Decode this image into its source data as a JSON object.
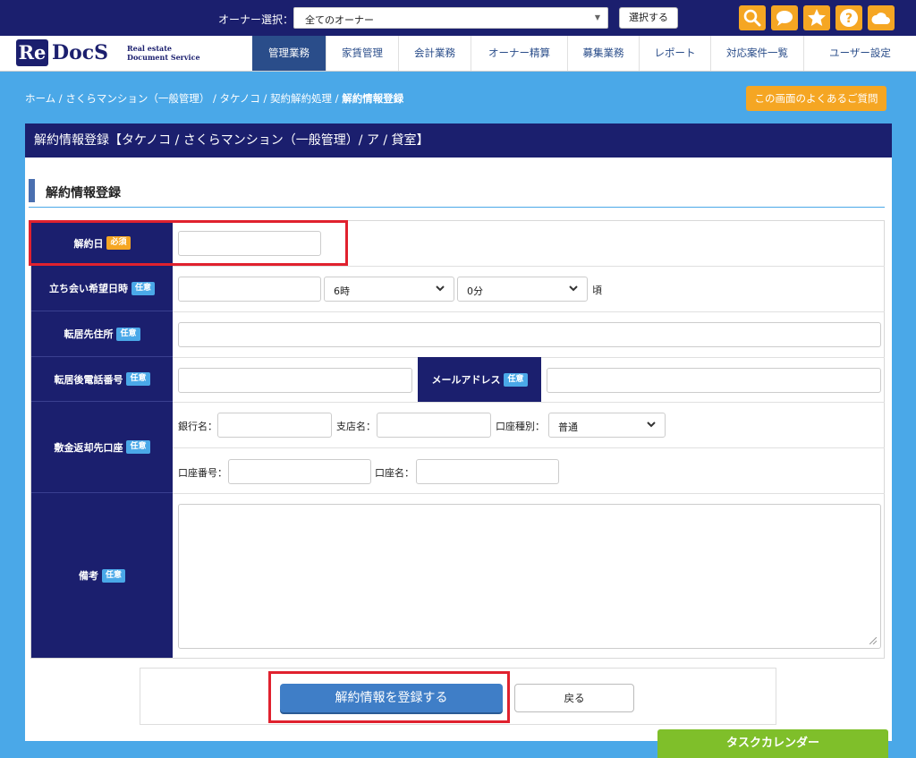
{
  "topbar": {
    "owner_label": "オーナー選択：",
    "owner_select_value": "全てのオーナー",
    "select_button": "選択する",
    "icons": [
      "search-icon",
      "chat-icon",
      "star-icon",
      "help-icon",
      "cloud-icon"
    ]
  },
  "logo": {
    "re": "Re",
    "docs": "DocS",
    "sub_line1": "Real estate",
    "sub_line2": "Document Service"
  },
  "nav": {
    "items": [
      "管理業務",
      "家賃管理",
      "会計業務",
      "オーナー精算",
      "募集業務",
      "レポート",
      "対応案件一覧",
      "ユーザー設定"
    ],
    "active_index": 0
  },
  "breadcrumb": {
    "items": [
      "ホーム",
      "さくらマンション（一般管理）",
      "タケノコ",
      "契約解約処理"
    ],
    "separator": " / ",
    "current": "解約情報登録"
  },
  "faq_button": "この画面のよくあるご質問",
  "panel": {
    "header": "解約情報登録【タケノコ / さくらマンション（一般管理）/ ア / 貸室】",
    "section_title": "解約情報登録"
  },
  "badges": {
    "required": "必須",
    "optional": "任意"
  },
  "form": {
    "cancel_date": {
      "label": "解約日",
      "value": ""
    },
    "visit_datetime": {
      "label": "立ち会い希望日時",
      "date_value": "",
      "hour": "6時",
      "minute": "0分",
      "suffix": "頃"
    },
    "new_address": {
      "label": "転居先住所",
      "value": ""
    },
    "new_phone": {
      "label": "転居後電話番号",
      "value": ""
    },
    "email": {
      "label": "メールアドレス",
      "value": ""
    },
    "refund_account": {
      "label": "敷金返却先口座",
      "bank_label": "銀行名：",
      "branch_label": "支店名：",
      "type_label": "口座種別：",
      "type_value": "普通",
      "number_label": "口座番号：",
      "name_label": "口座名："
    },
    "remarks": {
      "label": "備考",
      "value": ""
    }
  },
  "buttons": {
    "submit": "解約情報を登録する",
    "back": "戻る"
  },
  "task_calendar": "タスクカレンダー",
  "colors": {
    "navy": "#1b1f6e",
    "sky": "#4aa8e8",
    "orange": "#f5a623",
    "green": "#7fbf2a",
    "highlight_red": "#e0212e"
  }
}
